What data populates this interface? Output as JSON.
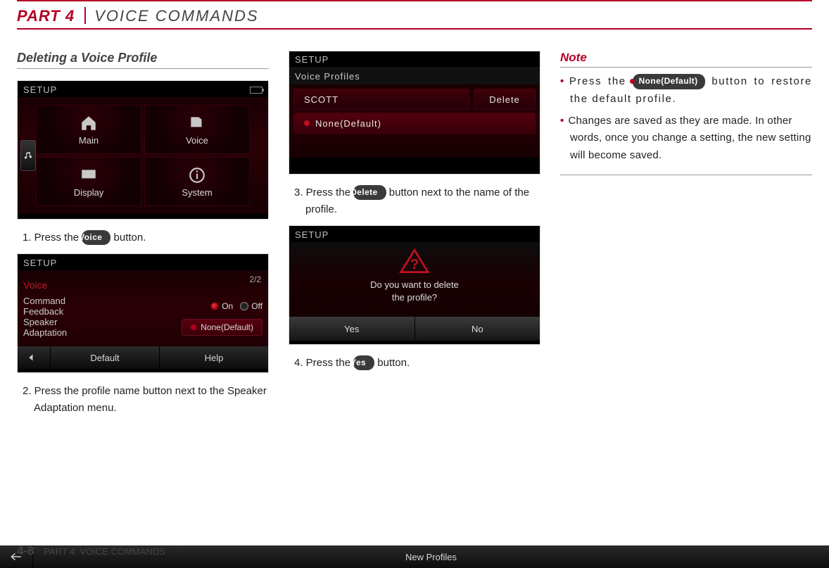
{
  "header": {
    "part": "PART 4",
    "title": "VOICE COMMANDS"
  },
  "footer": {
    "page": "4-8",
    "label": "PART 4. VOICE COMMANDS"
  },
  "col1": {
    "subhead": "Deleting a Voice Profile",
    "step1_pre": "1. Press the ",
    "step1_btn": "Voice",
    "step1_post": " button.",
    "step2": "2. Press the profile name button next to the Speaker Adaptation menu."
  },
  "col2": {
    "step3_pre": "3. Press the ",
    "step3_btn": "Delete",
    "step3_post": " button next to the name of the profile.",
    "step4_pre": "4. Press the ",
    "step4_btn": "Yes",
    "step4_post": " button."
  },
  "col3": {
    "note_head": "Note",
    "n1_pre": "Press the ",
    "n1_btn": "None(Default)",
    "n1_post": " button to restore the default profile.",
    "n2": "Changes are saved as they are made. In other words, once you change a setting, the new setting will become saved."
  },
  "shot1": {
    "title": "SETUP",
    "tiles": [
      "Main",
      "Voice",
      "Display",
      "System"
    ]
  },
  "shot2": {
    "title": "SETUP",
    "voice": "Voice",
    "page": "2/2",
    "row1a": "Command",
    "row1b": "Feedback",
    "on": "On",
    "off": "Off",
    "row2a": "Speaker",
    "row2b": "Adaptation",
    "profile": "None(Default)",
    "b_default": "Default",
    "b_help": "Help"
  },
  "shot3": {
    "title": "SETUP",
    "sub": "Voice Profiles",
    "name": "SCOTT",
    "delete": "Delete",
    "none": "None(Default)",
    "new": "New Profiles"
  },
  "shot4": {
    "title": "SETUP",
    "line1": "Do you want to delete",
    "line2": "the profile?",
    "yes": "Yes",
    "no": "No"
  }
}
